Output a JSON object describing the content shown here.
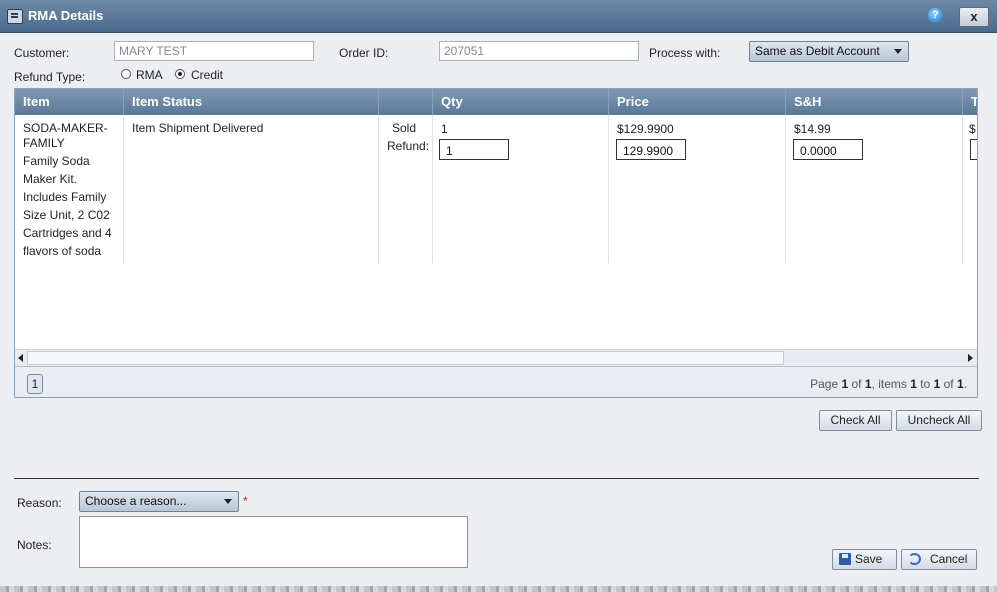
{
  "window": {
    "title": "RMA Details",
    "help_label": "?",
    "close_label": "x"
  },
  "form": {
    "customer_label": "Customer:",
    "customer_value": "MARY TEST",
    "order_id_label": "Order ID:",
    "order_id_value": "207051",
    "process_with_label": "Process with:",
    "process_with_value": "Same as Debit Account",
    "refund_type_label": "Refund Type:",
    "refund_options": [
      {
        "label": "RMA",
        "selected": false
      },
      {
        "label": "Credit",
        "selected": true
      }
    ]
  },
  "grid": {
    "columns": [
      "Item",
      "Item Status",
      "",
      "Qty",
      "Price",
      "S&H",
      "T"
    ],
    "row": {
      "item_lines": [
        "SODA-MAKER-",
        "FAMILY",
        "Family Soda",
        "Maker Kit.",
        "Includes Family",
        "Size Unit, 2 C02",
        "Cartridges and 4",
        "flavors of soda"
      ],
      "status": "Item Shipment Delivered",
      "sold_label": "Sold",
      "refund_label": "Refund:",
      "qty_sold": "1",
      "qty_refund": "1",
      "price_sold": "$129.9900",
      "price_refund": "129.9900",
      "sh_sold": "$14.99",
      "sh_refund": "0.0000",
      "t_partial": "$"
    },
    "pager": {
      "current_page": "1",
      "info_prefix": "Page ",
      "page": "1",
      "of_text": " of ",
      "total_pages": "1",
      "items_text": ", items ",
      "from": "1",
      "to_text": " to ",
      "to": "1",
      "of_text2": " of ",
      "total_items": "1",
      "end": "."
    }
  },
  "actions": {
    "check_all": "Check All",
    "uncheck_all": "Uncheck All"
  },
  "bottom": {
    "reason_label": "Reason:",
    "reason_placeholder": "Choose a reason...",
    "required_mark": "*",
    "notes_label": "Notes:",
    "save_label": "Save",
    "cancel_label": "Cancel"
  },
  "colors": {
    "header": "#5a7898",
    "accent": "#2a70c8",
    "required": "#d01010"
  },
  "icons": [
    "window-icon",
    "help-icon",
    "close-icon",
    "save-icon",
    "cancel-icon"
  ]
}
